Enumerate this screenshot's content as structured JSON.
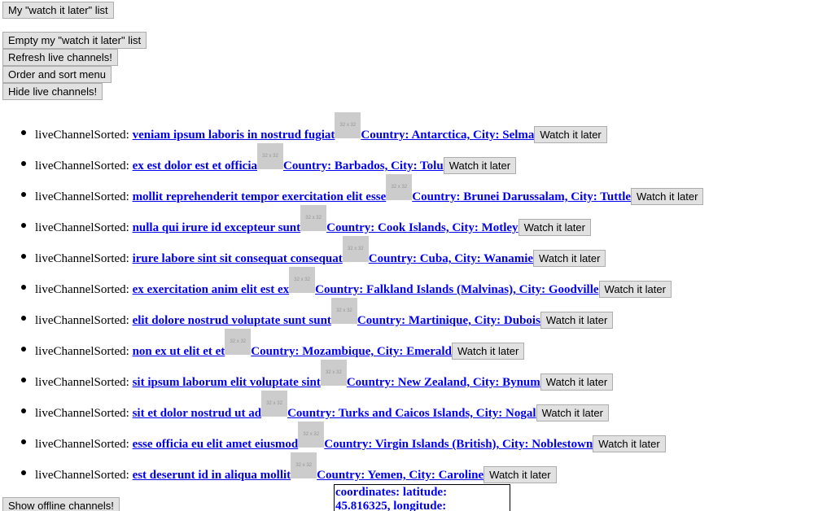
{
  "toolbar": {
    "watch_later_list": "My \"watch it later\" list",
    "empty_watch_later": "Empty my \"watch it later\" list",
    "refresh_live": "Refresh live channels!",
    "order_sort_menu": "Order and sort menu",
    "hide_live": "Hide live channels!"
  },
  "channels": [
    {
      "prefix": "liveChannelSorted: ",
      "title": "veniam ipsum laboris in nostrud fugiat",
      "thumb": "32 x 32",
      "location": "Country: Antarctica, City: Selma",
      "action": "Watch it later"
    },
    {
      "prefix": "liveChannelSorted: ",
      "title": "ex est dolor est et officia",
      "thumb": "32 x 32",
      "location": "Country: Barbados, City: Tolu",
      "action": "Watch it later"
    },
    {
      "prefix": "liveChannelSorted: ",
      "title": "mollit reprehenderit tempor exercitation elit esse",
      "thumb": "32 x 32",
      "location": "Country: Brunei Darussalam, City: Tuttle",
      "action": "Watch it later"
    },
    {
      "prefix": "liveChannelSorted: ",
      "title": "nulla qui irure id excepteur sunt",
      "thumb": "32 x 32",
      "location": "Country: Cook Islands, City: Motley",
      "action": "Watch it later"
    },
    {
      "prefix": "liveChannelSorted: ",
      "title": "irure labore sint sit consequat consequat",
      "thumb": "32 x 32",
      "location": "Country: Cuba, City: Wanamie",
      "action": "Watch it later"
    },
    {
      "prefix": "liveChannelSorted: ",
      "title": "ex exercitation anim elit est ex",
      "thumb": "32 x 32",
      "location": "Country: Falkland Islands (Malvinas), City: Goodville",
      "action": "Watch it later"
    },
    {
      "prefix": "liveChannelSorted: ",
      "title": "elit dolore nostrud voluptate sunt sunt",
      "thumb": "32 x 32",
      "location": "Country: Martinique, City: Dubois",
      "action": "Watch it later"
    },
    {
      "prefix": "liveChannelSorted: ",
      "title": "non ex ut elit et et",
      "thumb": "32 x 32",
      "location": "Country: Mozambique, City: Emerald",
      "action": "Watch it later"
    },
    {
      "prefix": "liveChannelSorted: ",
      "title": "sit ipsum laborum elit voluptate sint",
      "thumb": "32 x 32",
      "location": "Country: New Zealand, City: Bynum",
      "action": "Watch it later"
    },
    {
      "prefix": "liveChannelSorted: ",
      "title": "sit et dolor nostrud ut ad",
      "thumb": "32 x 32",
      "location": "Country: Turks and Caicos Islands, City: Nogal",
      "action": "Watch it later"
    },
    {
      "prefix": "liveChannelSorted: ",
      "title": "esse officia eu elit amet eiusmod",
      "thumb": "32 x 32",
      "location": "Country: Virgin Islands (British), City: Noblestown",
      "action": "Watch it later"
    },
    {
      "prefix": "liveChannelSorted: ",
      "title": "est deserunt id in aliqua mollit",
      "thumb": "32 x 32",
      "location": "Country: Yemen, City: Caroline",
      "action": "Watch it later"
    }
  ],
  "tooltip": {
    "line1": "coordinates: latitude:",
    "line2": "45.816325, longitude:"
  },
  "footer": {
    "show_offline": "Show offline channels!"
  },
  "colors": {
    "link": "#0000ee",
    "button_bg": "#e1e1e1",
    "thumb_bg": "#cccccc"
  }
}
